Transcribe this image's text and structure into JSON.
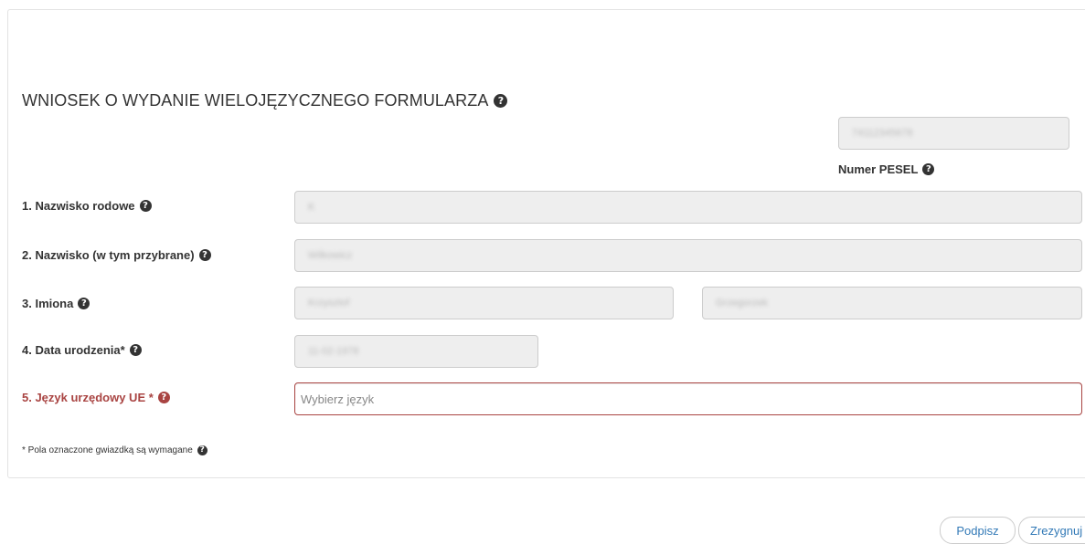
{
  "form": {
    "title": "WNIOSEK O WYDANIE WIELOJĘZYCZNEGO FORMULARZA",
    "pesel": {
      "label": "Numer PESEL",
      "value": "74112345678"
    },
    "fields": {
      "maiden_name": {
        "label": "1. Nazwisko rodowe",
        "value": "K"
      },
      "surname": {
        "label": "2. Nazwisko (w tym przybrane)",
        "value": "Wilkowicz"
      },
      "first_names": {
        "label": "3. Imiona",
        "value_1": "Krzysztof",
        "value_2": "Grzegorzek"
      },
      "birth_date": {
        "label": "4. Data urodzenia*",
        "value": "11-02-1978"
      },
      "language": {
        "label": "5. Język urzędowy UE *",
        "placeholder": "Wybierz język"
      }
    },
    "footnote": "* Pola oznaczone gwiazdką są wymagane"
  },
  "actions": {
    "sign_label": "Podpisz",
    "cancel_label": "Zrezygnuj"
  },
  "icons": {
    "help": "question-circle-icon"
  },
  "colors": {
    "error": "#a94442",
    "link": "#337ab7",
    "readonly_bg": "#eeeeee"
  }
}
